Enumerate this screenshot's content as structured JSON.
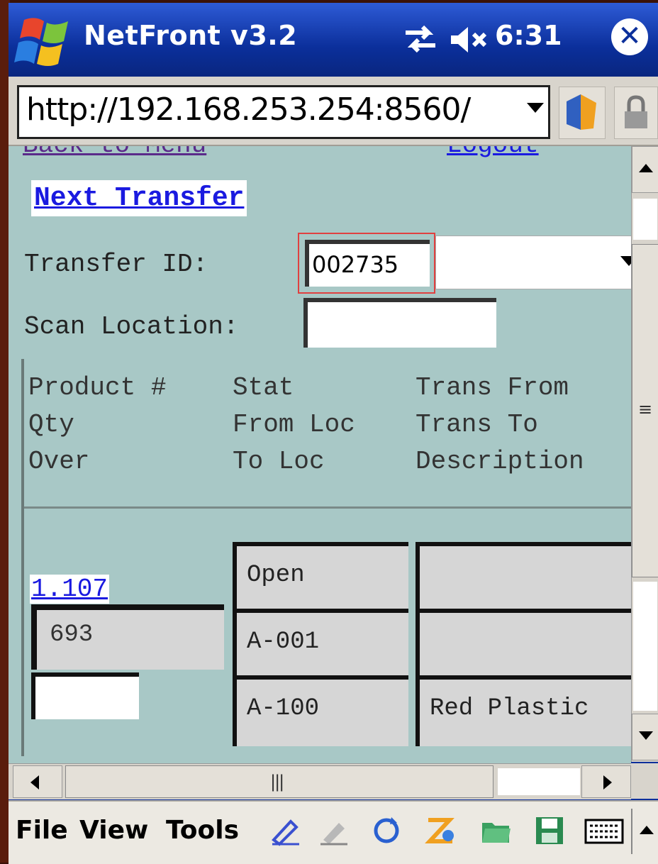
{
  "title_bar": {
    "app_title": "NetFront v3.2",
    "time": "6:31",
    "close_glyph": "✕"
  },
  "address_bar": {
    "url": "http://192.168.253.254:8560/"
  },
  "page": {
    "back_link": "Back to Menu",
    "logout_link": "Logout",
    "next_transfer": "Next Transfer",
    "transfer_id_label": "Transfer ID:",
    "transfer_id_value": "002735",
    "scan_location_label": "Scan Location:",
    "columns": {
      "col1": [
        "Product #",
        "Qty",
        "Over"
      ],
      "col2": [
        "Stat",
        "From Loc",
        "To Loc"
      ],
      "col3": [
        "Trans From",
        "Trans To",
        "Description"
      ]
    },
    "row": {
      "product": "1.107",
      "qty": "693",
      "stat": "Open",
      "from_loc": "A-001",
      "to_loc": "A-100",
      "trans_from": "",
      "trans_to": "",
      "description": "Red Plastic"
    }
  },
  "scrollbars": {
    "grip_v": "≡",
    "grip_h": "|||"
  },
  "menu_bar": {
    "file": "File",
    "view": "View",
    "tools": "Tools",
    "icons": [
      "pencil-icon",
      "highlighter-icon",
      "refresh-icon",
      "zoom-icon",
      "folder-icon",
      "save-icon",
      "keyboard-icon"
    ]
  },
  "colors": {
    "title_bar": "#0b2f9b",
    "page_background": "#a8c8c6",
    "link": "#1a1ae0",
    "focus_border": "#e04040"
  }
}
